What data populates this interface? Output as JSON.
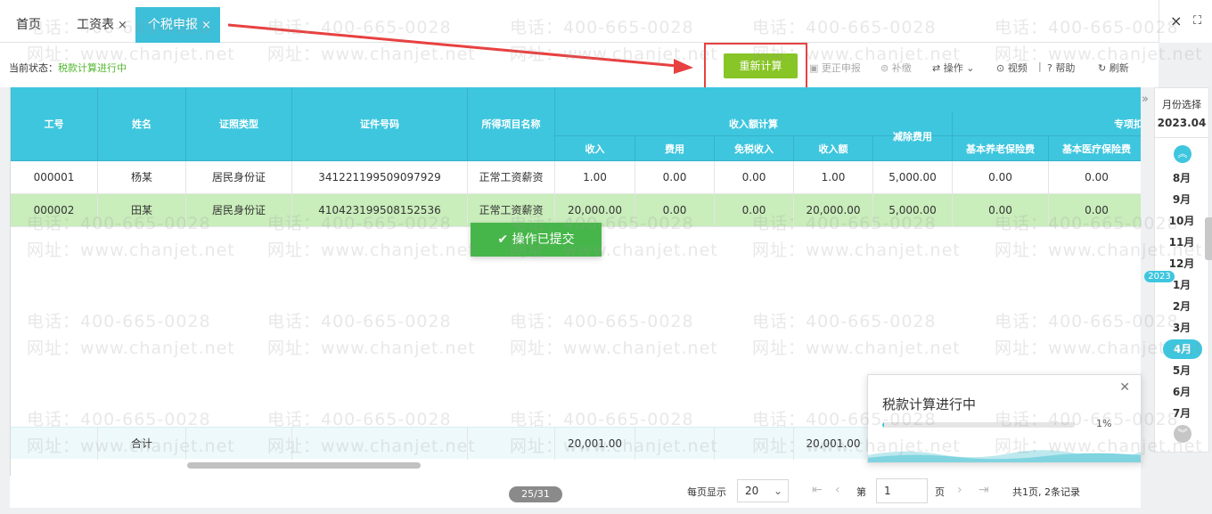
{
  "tabs": [
    {
      "label": "首页",
      "closable": false,
      "active": false
    },
    {
      "label": "工资表",
      "closable": true,
      "active": false
    },
    {
      "label": "个税申报",
      "closable": true,
      "active": true
    }
  ],
  "window_controls": {
    "close": "×",
    "fullscreen": "⛶"
  },
  "toolbar": {
    "status_label": "当前状态：",
    "status_value": "税款计算进行中",
    "recalc_label": "重新计算",
    "correct_label": "更正申报",
    "supplement_label": "补缴",
    "operate_label": "操作",
    "video_label": "视频",
    "separator": "|",
    "help_label": "帮助",
    "refresh_label": "刷新"
  },
  "table": {
    "headers": {
      "emp_no": "工号",
      "name": "姓名",
      "id_type": "证照类型",
      "id_no": "证件号码",
      "income_item": "所得项目名称",
      "income_group": "收入额计算",
      "income": "收入",
      "expense": "费用",
      "tax_free": "免税收入",
      "income_amount": "收入额",
      "deduction": "减除费用",
      "special_group": "专项扣除",
      "pension": "基本养老保险费",
      "medical": "基本医疗保险费"
    },
    "rows": [
      {
        "emp_no": "000001",
        "name": "杨某",
        "id_type": "居民身份证",
        "id_no": "341221199509097929",
        "income_item": "正常工资薪资",
        "income": "1.00",
        "expense": "0.00",
        "tax_free": "0.00",
        "income_amount": "1.00",
        "deduction": "5,000.00",
        "pension": "0.00",
        "medical": "0.00"
      },
      {
        "emp_no": "000002",
        "name": "田某",
        "id_type": "居民身份证",
        "id_no": "410423199508152536",
        "income_item": "正常工资薪资",
        "income": "20,000.00",
        "expense": "0.00",
        "tax_free": "0.00",
        "income_amount": "20,000.00",
        "deduction": "5,000.00",
        "pension": "0.00",
        "medical": "0.00"
      }
    ],
    "total": {
      "label": "合计",
      "income": "20,001.00",
      "income_amount": "20,001.00"
    }
  },
  "toast": {
    "text": "操作已提交"
  },
  "progress": {
    "title": "税款计算进行中",
    "percent_text": "1%",
    "fraction": 0.01
  },
  "pager": {
    "page_indicator": "25/31",
    "per_page_label": "每页显示",
    "per_page_value": "20",
    "page_prefix": "第",
    "page_value": "1",
    "page_suffix": "页",
    "summary": "共1页, 2条记录"
  },
  "month_panel": {
    "title": "月份选择",
    "current": "2023.04",
    "year_badge": "2023",
    "months": [
      "8月",
      "9月",
      "10月",
      "11月",
      "12月",
      "1月",
      "2月",
      "3月",
      "4月",
      "5月",
      "6月",
      "7月"
    ],
    "selected": "4月",
    "collapse_icon": "»"
  },
  "watermark": {
    "phone": "电话：400-665-0028",
    "site": "网址：www.chanjet.net"
  },
  "colors": {
    "accent": "#3ec6de",
    "recalc": "#88c526",
    "selected_row": "#c9edbb",
    "status": "#55b832",
    "annotation": "#e84141",
    "toast": "#47b64a"
  }
}
